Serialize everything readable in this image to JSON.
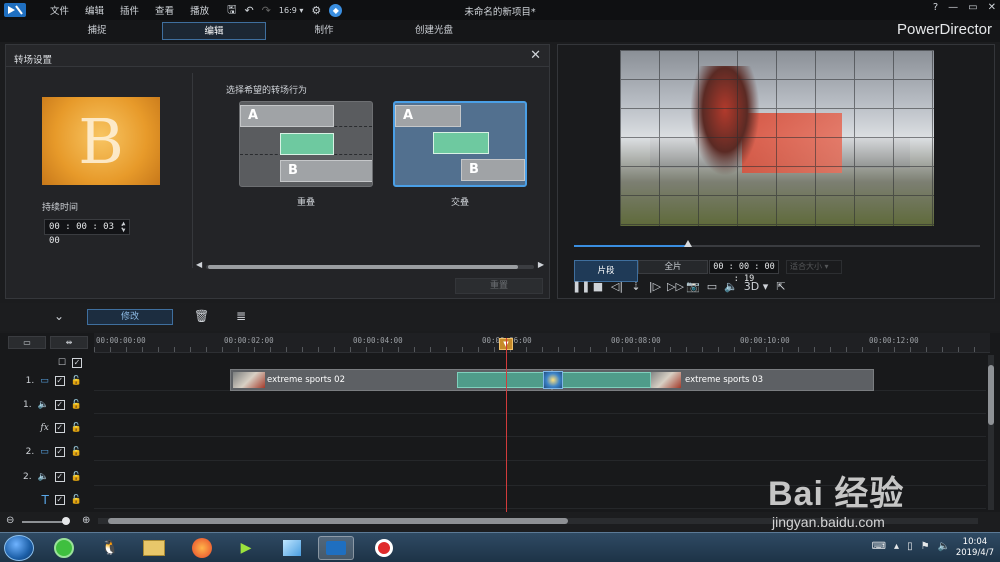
{
  "titlebar": {
    "menu": [
      "文件",
      "编辑",
      "插件",
      "查看",
      "播放"
    ],
    "window_title": "未命名的新项目*",
    "controls": [
      "?",
      "—",
      "▭",
      "✕"
    ]
  },
  "modes": [
    "捕捉",
    "编辑",
    "制作",
    "创建光盘"
  ],
  "active_mode": "编辑",
  "brand": "PowerDirector",
  "transition_panel": {
    "title": "转场设置",
    "thumbnail_letter": "B",
    "duration_label": "持续时间",
    "duration_value": "00 : 00 : 03 : 00",
    "choose_label": "选择希望的转场行为",
    "options": [
      {
        "label": "重叠",
        "a": "A",
        "b": "B",
        "selected": false
      },
      {
        "label": "交叠",
        "a": "A",
        "b": "B",
        "selected": true
      }
    ],
    "reset_label": "重置"
  },
  "preview": {
    "progress": 0.28,
    "clip_tab": "片段",
    "full_tab": "全片",
    "timecode": "00 : 00 : 00 : 19",
    "fit_label": "适合大小 ▾",
    "controls": [
      "❚❚",
      "■",
      "◁|",
      "⇣",
      "|▷",
      "▷▷",
      "📷",
      "▭",
      "🔈",
      "3D ▾",
      "⇱"
    ]
  },
  "timeline_toolbar": {
    "modify_label": "修改"
  },
  "timeline": {
    "ruler_labels": [
      "00:00:00:00",
      "00:00:02:00",
      "00:00:04:00",
      "00:00:06:00",
      "00:00:08:00",
      "00:00:10:00",
      "00:00:12:00"
    ],
    "tracks": [
      {
        "num": "",
        "icon": "☐"
      },
      {
        "num": "1.",
        "icon": "▭"
      },
      {
        "num": "1.",
        "icon": "🔈"
      },
      {
        "num": "",
        "icon": "fx"
      },
      {
        "num": "2.",
        "icon": "▭"
      },
      {
        "num": "2.",
        "icon": "🔈"
      },
      {
        "num": "",
        "icon": "T"
      }
    ],
    "clips": [
      {
        "name": "extreme sports 02"
      },
      {
        "name": "extreme sports 03"
      }
    ]
  },
  "taskbar": {
    "clock_time": "10:04",
    "clock_date": "2019/4/7"
  },
  "watermark": {
    "main": "Bai 经验",
    "sub": "jingyan.baidu.com"
  }
}
